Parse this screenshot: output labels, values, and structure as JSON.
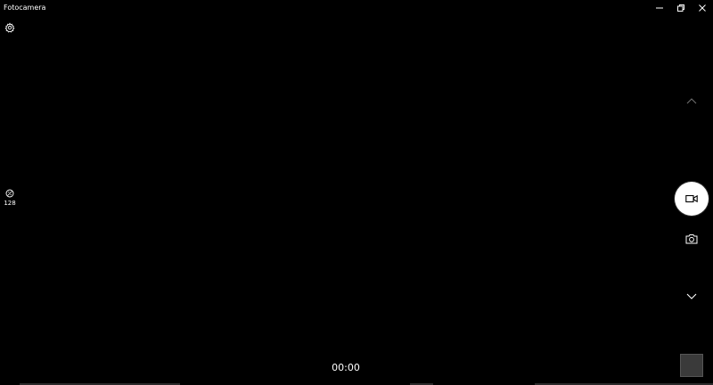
{
  "window": {
    "title": "Fotocamera",
    "controls": [
      "minimize-icon",
      "restore-icon",
      "close-icon"
    ]
  },
  "settings": {
    "icon": "gear-icon"
  },
  "exposure": {
    "icon": "iso-icon",
    "value": "128"
  },
  "capture": {
    "mode_up_icon": "chevron-up-icon",
    "shutter_icon": "video-camera-icon",
    "alt_mode_icon": "camera-icon",
    "mode_down_icon": "chevron-down-icon"
  },
  "recording": {
    "timer": "00:00"
  },
  "gallery": {
    "icon": "thumbnail"
  },
  "colors": {
    "background": "#000000",
    "foreground": "#ffffff",
    "muted": "#8a8a8a",
    "thumbnail": "#3a3a3a"
  }
}
